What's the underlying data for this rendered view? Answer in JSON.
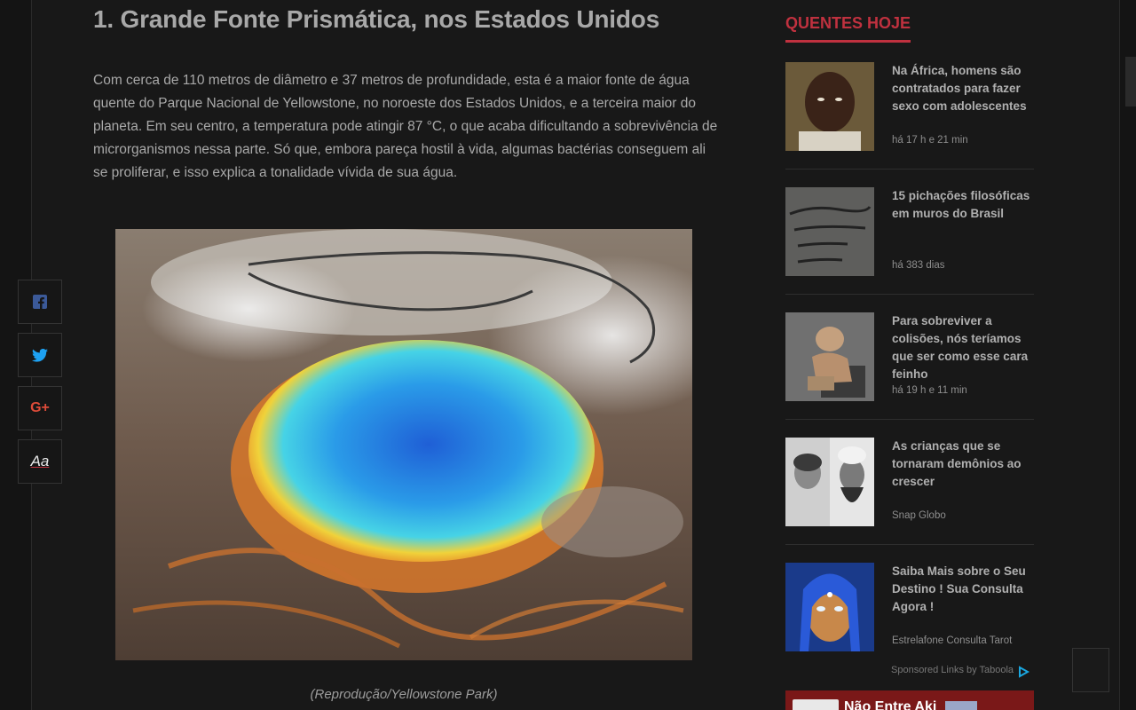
{
  "article": {
    "title": "1. Grande Fonte Prismática, nos Estados Unidos",
    "body": "Com cerca de 110 metros de diâmetro e 37 metros de profundidade, esta é a maior fonte de água quente do Parque Nacional de Yellowstone, no noroeste dos Estados Unidos, e a terceira maior do planeta. Em seu centro, a temperatura pode atingir 87 °C, o que acaba dificultando a sobrevivência de microrganismos nessa parte. Só que, embora pareça hostil à vida, algumas bactérias conseguem ali se proliferar, e isso explica a tonalidade vívida de sua água.",
    "caption": "(Reprodução/Yellowstone Park)"
  },
  "share": {
    "facebook_icon": "facebook-icon",
    "twitter_icon": "twitter-icon",
    "gplus_label": "G+",
    "font_label": "Aa"
  },
  "sidebar": {
    "heading": "QUENTES HOJE",
    "cards": [
      {
        "title": "Na África, homens são contratados para fazer sexo com adolescentes",
        "meta": "há 17 h e 21 min"
      },
      {
        "title": "15 pichações filosóficas em muros do Brasil",
        "meta": "há 383 dias"
      },
      {
        "title": "Para sobreviver a colisões, nós teríamos que ser como esse cara feinho",
        "meta": "há 19 h e 11 min"
      },
      {
        "title": "As crianças que se tornaram demônios ao crescer",
        "meta": "Snap Globo"
      },
      {
        "title": "Saiba Mais sobre o Seu Destino ! Sua Consulta Agora !",
        "meta": "Estrelafone Consulta Tarot"
      }
    ],
    "sponsored": "Sponsored Links by Taboola",
    "banner_text": "Não Entre Aki"
  },
  "colors": {
    "accent": "#c0313f",
    "background": "#141414"
  }
}
